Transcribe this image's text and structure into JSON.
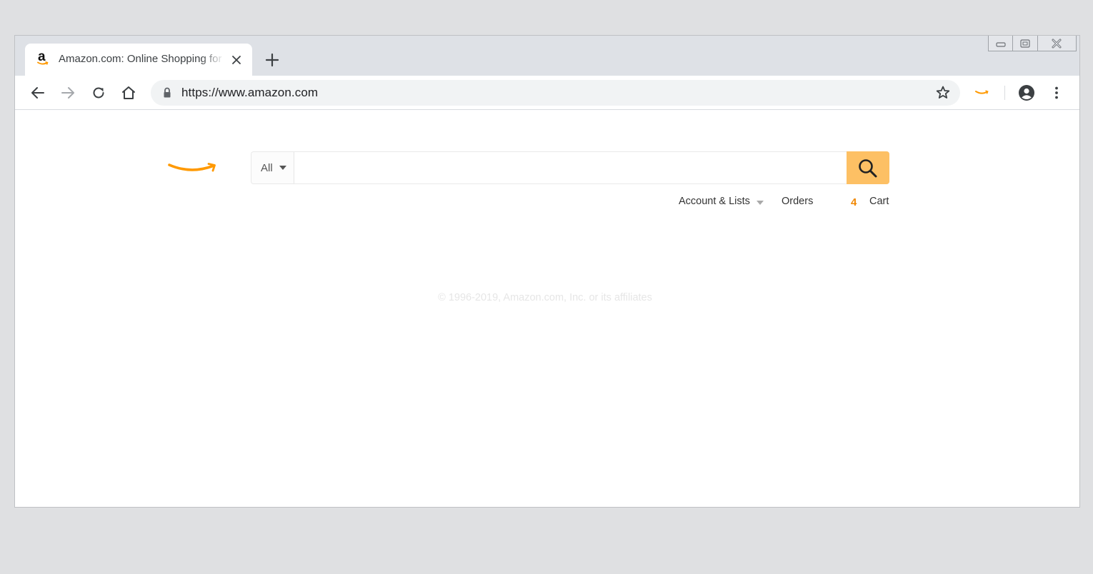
{
  "tab": {
    "title": "Amazon.com: Online Shopping for Electronics, Apparel, Computers, Books, DVDs & more",
    "favicon_letter": "a"
  },
  "toolbar": {
    "url": "https://www.amazon.com",
    "icons": [
      "back-arrow-icon",
      "forward-arrow-icon",
      "reload-icon",
      "home-icon",
      "lock-icon",
      "star-icon",
      "amazon-extension-icon",
      "account-circle-icon",
      "more-vert-icon"
    ]
  },
  "window_controls": [
    "minimize-icon",
    "restore-icon",
    "close-icon"
  ],
  "search": {
    "department_label": "All",
    "query": "",
    "placeholder": ""
  },
  "nav": {
    "account_label": "Account & Lists",
    "orders_label": "Orders",
    "cart_count": "4",
    "cart_label": "Cart"
  },
  "footer": {
    "copyright": "© 1996-2019, Amazon.com, Inc. or its affiliates"
  },
  "colors": {
    "brand_orange": "#ff9900",
    "search_button": "#fdc064",
    "cart_count": "#f08804",
    "tab_strip": "#dee1e6",
    "omnibox": "#f1f3f4"
  }
}
